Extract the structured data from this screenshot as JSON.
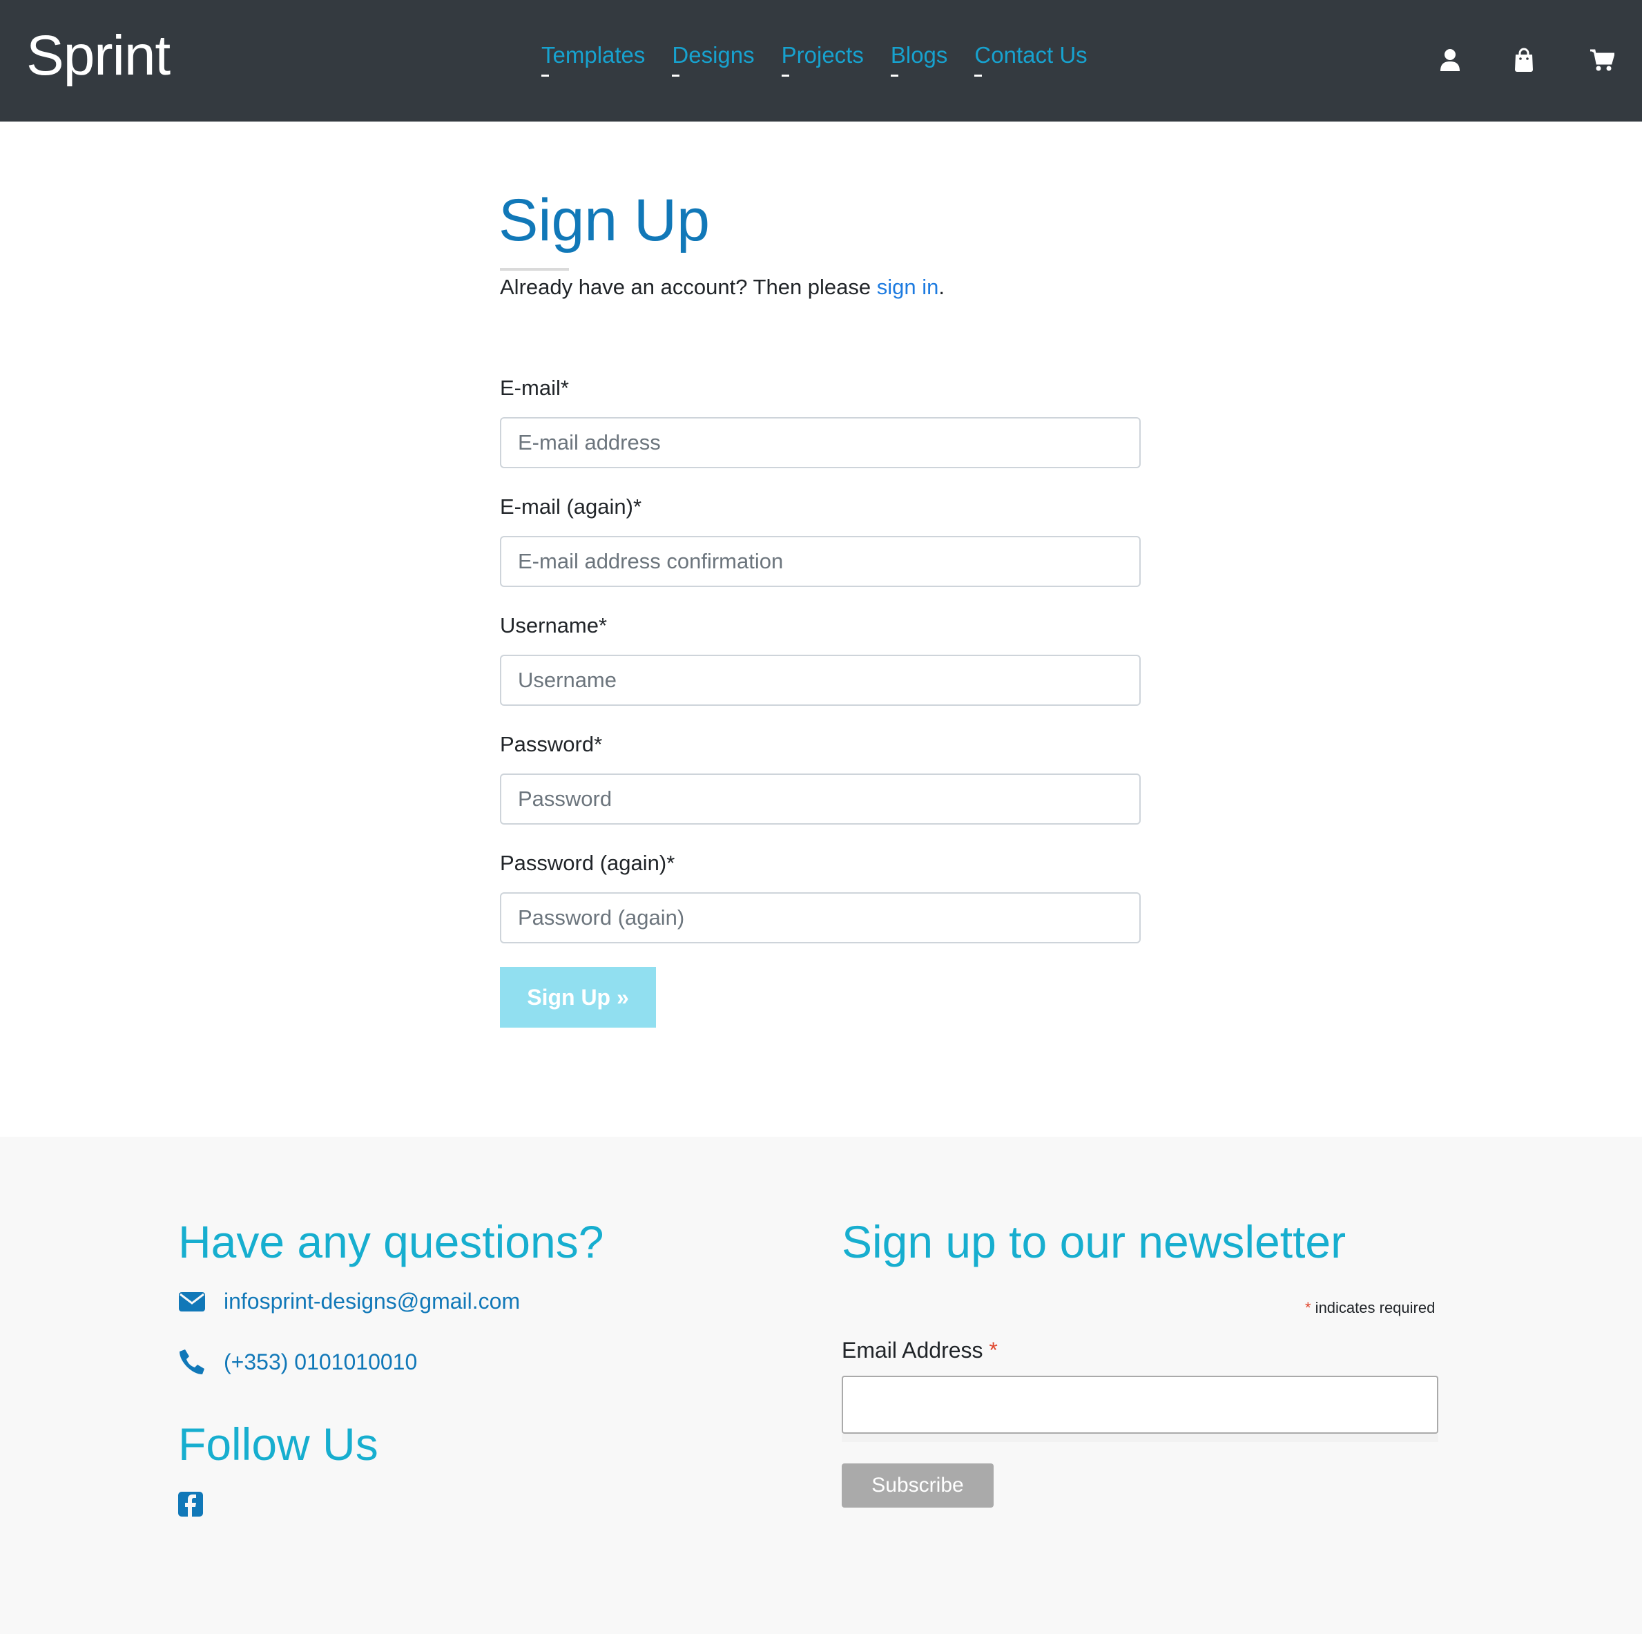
{
  "header": {
    "brand": "Sprint",
    "nav": [
      {
        "label": "Templates"
      },
      {
        "label": "Designs"
      },
      {
        "label": "Projects"
      },
      {
        "label": "Blogs"
      },
      {
        "label": "Contact Us"
      }
    ],
    "icons": [
      "user-icon",
      "shopping-bag-icon",
      "cart-icon"
    ]
  },
  "signup": {
    "title": "Sign Up",
    "intro_text": "Already have an account? Then please ",
    "intro_link": "sign in",
    "intro_end": ".",
    "fields": [
      {
        "label": "E-mail*",
        "placeholder": "E-mail address",
        "value": ""
      },
      {
        "label": "E-mail (again)*",
        "placeholder": "E-mail address confirmation",
        "value": ""
      },
      {
        "label": "Username*",
        "placeholder": "Username",
        "value": ""
      },
      {
        "label": "Password*",
        "placeholder": "Password",
        "value": ""
      },
      {
        "label": "Password (again)*",
        "placeholder": "Password (again)",
        "value": ""
      }
    ],
    "submit_label": "Sign Up »"
  },
  "footer": {
    "questions_heading": "Have any questions?",
    "email": "infosprint-designs@gmail.com",
    "phone": "(+353) 0101010010",
    "follow_heading": "Follow Us",
    "newsletter_heading": "Sign up to our newsletter",
    "required_star": "*",
    "required_text": " indicates required",
    "email_label": "Email Address",
    "email_value": "",
    "subscribe_label": "Subscribe"
  },
  "colors": {
    "navbar_bg": "#343a40",
    "nav_link": "#17a2cf",
    "title": "#1178b8",
    "signup_button": "#91dff0",
    "footer_heading": "#17aecf",
    "footer_bg": "#f8f8f8",
    "required_star": "#e0482f"
  }
}
